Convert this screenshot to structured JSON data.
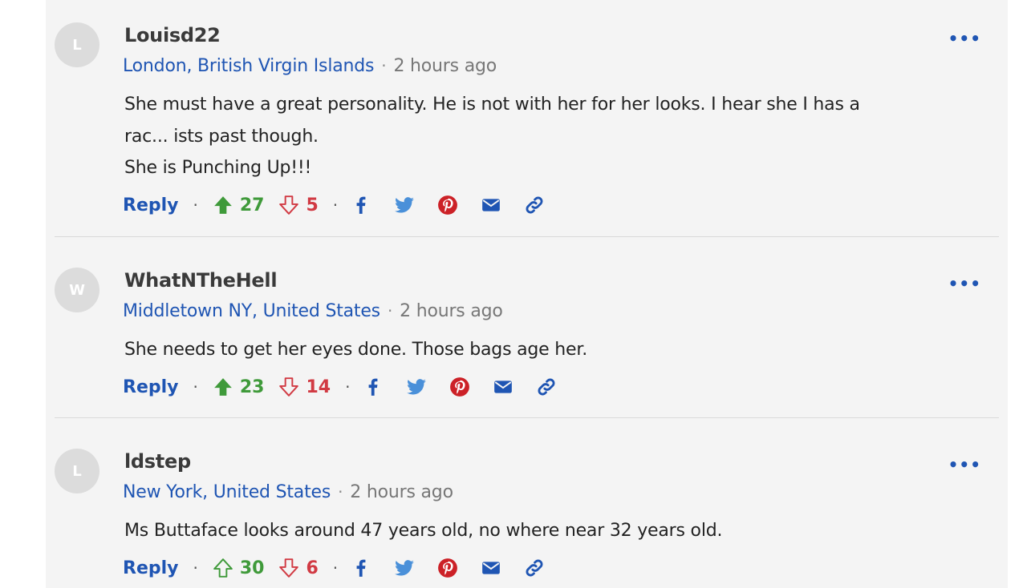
{
  "comments": [
    {
      "avatar_letter": "L",
      "username": "Louisd22",
      "location": "London, British Virgin Islands",
      "time": "2 hours ago",
      "lines": [
        "She must have a great personality. He is not with her for her looks. I hear she I has a",
        "rac... ists past though.",
        "She is Punching Up!!!"
      ],
      "reply_label": "Reply",
      "upvotes": "27",
      "downvotes": "5",
      "upvoted": true,
      "more": "•••"
    },
    {
      "avatar_letter": "W",
      "username": "WhatNTheHell",
      "location": "Middletown NY, United States",
      "time": "2 hours ago",
      "lines": [
        "She needs to get her eyes done. Those bags age her."
      ],
      "reply_label": "Reply",
      "upvotes": "23",
      "downvotes": "14",
      "upvoted": true,
      "more": "•••"
    },
    {
      "avatar_letter": "L",
      "username": "ldstep",
      "location": "New York, United States",
      "time": "2 hours ago",
      "lines": [
        "Ms Buttaface looks around 47 years old, no where near 32 years old."
      ],
      "reply_label": "Reply",
      "upvotes": "30",
      "downvotes": "6",
      "upvoted": false,
      "more": "•••"
    }
  ],
  "separator": "·",
  "share_icons": [
    "facebook-icon",
    "twitter-icon",
    "pinterest-icon",
    "email-icon",
    "link-icon"
  ],
  "colors": {
    "link_blue": "#1f55b3",
    "upvote_green": "#3f9a3a",
    "downvote_red": "#d13a43",
    "facebook_blue": "#1f55b3",
    "twitter_blue": "#4a90d9",
    "pinterest_red": "#cc2127",
    "panel_bg": "#f4f4f4"
  }
}
